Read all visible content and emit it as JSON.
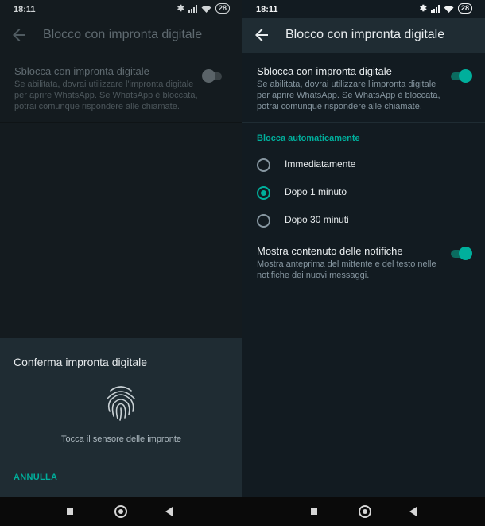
{
  "status_bar": {
    "time": "18:11",
    "battery": "28"
  },
  "appbar": {
    "title": "Blocco con impronta digitale"
  },
  "setting_unlock": {
    "title": "Sblocca con impronta digitale",
    "description": "Se abilitata, dovrai utilizzare l'impronta digitale per aprire WhatsApp. Se WhatsApp è bloccata, potrai comunque rispondere alle chiamate."
  },
  "auto_lock": {
    "section_title": "Blocca automaticamente",
    "options": [
      {
        "label": "Immediatamente",
        "selected": false
      },
      {
        "label": "Dopo 1 minuto",
        "selected": true
      },
      {
        "label": "Dopo 30 minuti",
        "selected": false
      }
    ]
  },
  "setting_notifications": {
    "title": "Mostra contenuto delle notifiche",
    "description": "Mostra anteprima del mittente e del testo nelle notifiche dei nuovi messaggi."
  },
  "dialog": {
    "title": "Conferma impronta digitale",
    "message": "Tocca il sensore delle impronte",
    "cancel_label": "ANNULLA"
  },
  "colors": {
    "accent": "#00af9c",
    "background": "#121b21",
    "sheet": "#1f2c33"
  }
}
